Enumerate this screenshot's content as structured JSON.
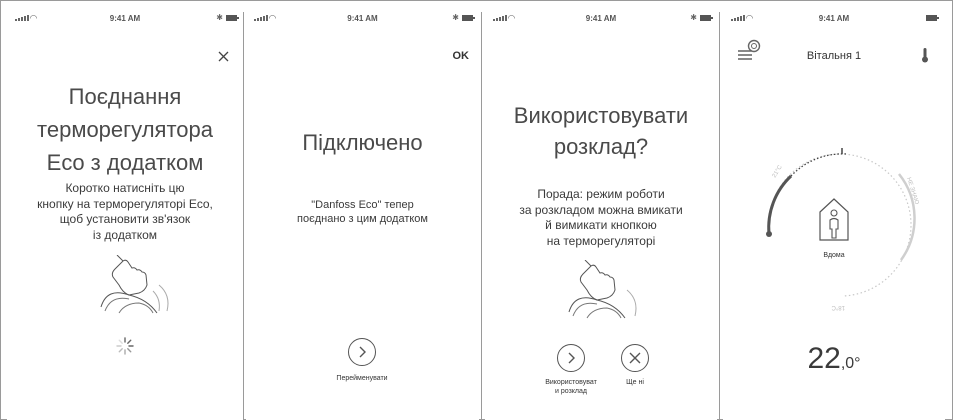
{
  "screens": [
    {
      "status": {
        "time": "9:41 AM"
      },
      "close_icon": "close-icon",
      "title_lines": [
        "Поєднання",
        "терморегулятора",
        "Eco з додатком"
      ],
      "body_lines": [
        "Коротко натисніть цю",
        "кнопку на терморегуляторі Eco,",
        "щоб установити зв'язок",
        "із додатком"
      ]
    },
    {
      "status": {
        "time": "9:41 AM"
      },
      "ok_label": "OK",
      "title": "Підключено",
      "body_lines": [
        "\"Danfoss Eco\" тепер",
        "поєднано з цим додатком"
      ],
      "rename_label": "Перейменувати"
    },
    {
      "status": {
        "time": "9:41 AM"
      },
      "title_lines": [
        "Використовувати",
        "розклад?"
      ],
      "body_lines": [
        "Порада: режим роботи",
        "за розкладом можна вмикати",
        "й вимикати кнопкою",
        "на терморегуляторі"
      ],
      "use_schedule_label_lines": [
        "Використовуват",
        "и розклад"
      ],
      "not_yet_label": "Ще ні"
    },
    {
      "status": {
        "time": "9:41 AM"
      },
      "room_title": "Вітальня 1",
      "mode_label": "Вдома",
      "gauge_labels": {
        "top_left": "21°C",
        "right": "НЕ ЗНАЮ",
        "bottom": "18°C"
      },
      "temperature": {
        "whole": "22",
        "decimal": ",0°"
      }
    }
  ],
  "colors": {
    "ink": "#3a3a3a",
    "gauge_active": "#555555",
    "gauge_inactive": "#c8c8c8"
  }
}
